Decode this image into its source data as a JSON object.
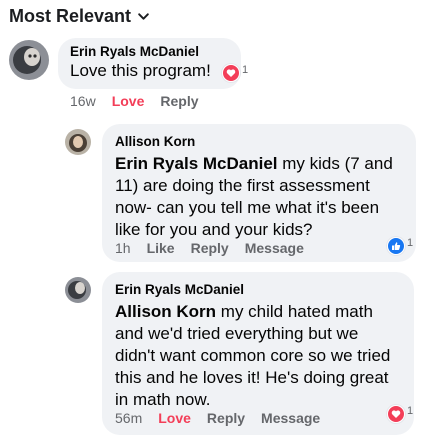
{
  "sort": {
    "label": "Most Relevant"
  },
  "comments": [
    {
      "author": "Erin Ryals McDaniel",
      "text": "Love this program!",
      "time": "16w",
      "actions": [
        "Love",
        "Reply"
      ],
      "reaction": {
        "type": "love",
        "count": "1"
      }
    },
    {
      "author": "Allison Korn",
      "mention": "Erin Ryals McDaniel",
      "text": " my kids (7 and 11) are doing the first assessment now- can you tell me what it's been like for you and your kids?",
      "time": "1h",
      "actions": [
        "Like",
        "Reply",
        "Message"
      ],
      "reaction": {
        "type": "like",
        "count": "1"
      }
    },
    {
      "author": "Erin Ryals McDaniel",
      "mention": "Allison Korn",
      "text": " my child hated math and we'd tried everything but we didn't want common core so we tried this and he loves it! He's doing great in math now.",
      "time": "56m",
      "actions": [
        "Love",
        "Reply",
        "Message"
      ],
      "reaction": {
        "type": "love",
        "count": "1"
      }
    }
  ],
  "colors": {
    "love": "#f33e58",
    "like": "#1877f2",
    "bubble": "#f0f2f5",
    "meta": "#65676b"
  }
}
